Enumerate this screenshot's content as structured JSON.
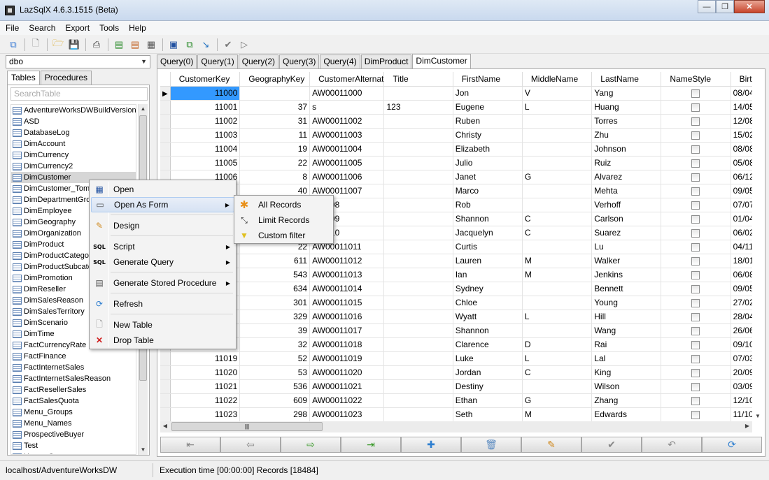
{
  "window": {
    "title": "LazSqlX 4.6.3.1515 (Beta)",
    "minimize": "—",
    "maximize": "❐",
    "close": "✕"
  },
  "menu": [
    "File",
    "Search",
    "Export",
    "Tools",
    "Help"
  ],
  "toolbar": {
    "icons": [
      "connect-icon",
      "new-icon",
      "open-icon",
      "save-icon",
      "print-icon",
      "export-icon",
      "script-icon",
      "generate-icon",
      "design-icon",
      "copy-icon",
      "import-icon",
      "check-icon",
      "run-icon"
    ]
  },
  "schema": {
    "value": "dbo"
  },
  "left_tabs": [
    "Tables",
    "Procedures"
  ],
  "search": {
    "placeholder": "SearchTable"
  },
  "tables": [
    "AdventureWorksDWBuildVersion",
    "ASD",
    "DatabaseLog",
    "DimAccount",
    "DimCurrency",
    "DimCurrency2",
    "DimCustomer",
    "DimCustomer_Tomb",
    "DimDepartmentGrou",
    "DimEmployee",
    "DimGeography",
    "DimOrganization",
    "DimProduct",
    "DimProductCategor",
    "DimProductSubcate",
    "DimPromotion",
    "DimReseller",
    "DimSalesReason",
    "DimSalesTerritory",
    "DimScenario",
    "DimTime",
    "FactCurrencyRate",
    "FactFinance",
    "FactInternetSales",
    "FactInternetSalesReason",
    "FactResellerSales",
    "FactSalesQuota",
    "Menu_Groups",
    "Menu_Names",
    "ProspectiveBuyer",
    "Test",
    "Users_Groups"
  ],
  "selected_table": "DimCustomer",
  "query_tabs": [
    "Query(0)",
    "Query(1)",
    "Query(2)",
    "Query(3)",
    "Query(4)",
    "DimProduct",
    "DimCustomer"
  ],
  "active_tab": "DimCustomer",
  "grid": {
    "columns": [
      "CustomerKey",
      "GeographyKey",
      "CustomerAlternat",
      "Title",
      "FirstName",
      "MiddleName",
      "LastName",
      "NameStyle",
      "BirthD"
    ],
    "rows": [
      [
        "11000",
        "",
        "AW00011000",
        "",
        "Jon",
        "V",
        "Yang",
        "",
        "08/04"
      ],
      [
        "11001",
        "37",
        "s",
        "123",
        "Eugene",
        "L",
        "Huang",
        "",
        "14/05"
      ],
      [
        "11002",
        "31",
        "AW00011002",
        "",
        "Ruben",
        "",
        "Torres",
        "",
        "12/08"
      ],
      [
        "11003",
        "11",
        "AW00011003",
        "",
        "Christy",
        "",
        "Zhu",
        "",
        "15/02"
      ],
      [
        "11004",
        "19",
        "AW00011004",
        "",
        "Elizabeth",
        "",
        "Johnson",
        "",
        "08/08"
      ],
      [
        "11005",
        "22",
        "AW00011005",
        "",
        "Julio",
        "",
        "Ruiz",
        "",
        "05/08"
      ],
      [
        "11006",
        "8",
        "AW00011006",
        "",
        "Janet",
        "G",
        "Alvarez",
        "",
        "06/12"
      ],
      [
        "",
        "40",
        "AW00011007",
        "",
        "Marco",
        "",
        "Mehta",
        "",
        "09/05"
      ],
      [
        "",
        "",
        "011008",
        "",
        "Rob",
        "",
        "Verhoff",
        "",
        "07/07"
      ],
      [
        "",
        "",
        "011009",
        "",
        "Shannon",
        "C",
        "Carlson",
        "",
        "01/04"
      ],
      [
        "",
        "",
        "011010",
        "",
        "Jacquelyn",
        "C",
        "Suarez",
        "",
        "06/02"
      ],
      [
        "",
        "22",
        "AW00011011",
        "",
        "Curtis",
        "",
        "Lu",
        "",
        "04/11"
      ],
      [
        "",
        "611",
        "AW00011012",
        "",
        "Lauren",
        "M",
        "Walker",
        "",
        "18/01"
      ],
      [
        "",
        "543",
        "AW00011013",
        "",
        "Ian",
        "M",
        "Jenkins",
        "",
        "06/08"
      ],
      [
        "",
        "634",
        "AW00011014",
        "",
        "Sydney",
        "",
        "Bennett",
        "",
        "09/05"
      ],
      [
        "",
        "301",
        "AW00011015",
        "",
        "Chloe",
        "",
        "Young",
        "",
        "27/02"
      ],
      [
        "",
        "329",
        "AW00011016",
        "",
        "Wyatt",
        "L",
        "Hill",
        "",
        "28/04"
      ],
      [
        "",
        "39",
        "AW00011017",
        "",
        "Shannon",
        "",
        "Wang",
        "",
        "26/06"
      ],
      [
        "",
        "32",
        "AW00011018",
        "",
        "Clarence",
        "D",
        "Rai",
        "",
        "09/10"
      ],
      [
        "11019",
        "52",
        "AW00011019",
        "",
        "Luke",
        "L",
        "Lal",
        "",
        "07/03"
      ],
      [
        "11020",
        "53",
        "AW00011020",
        "",
        "Jordan",
        "C",
        "King",
        "",
        "20/09"
      ],
      [
        "11021",
        "536",
        "AW00011021",
        "",
        "Destiny",
        "",
        "Wilson",
        "",
        "03/09"
      ],
      [
        "11022",
        "609",
        "AW00011022",
        "",
        "Ethan",
        "G",
        "Zhang",
        "",
        "12/10"
      ],
      [
        "11023",
        "298",
        "AW00011023",
        "",
        "Seth",
        "M",
        "Edwards",
        "",
        "11/10"
      ]
    ]
  },
  "nav_buttons": [
    "first-icon",
    "prior-icon",
    "next-icon",
    "last-icon",
    "insert-icon",
    "delete-icon",
    "edit-icon",
    "post-icon",
    "cancel-icon",
    "refresh-icon"
  ],
  "context_menu": {
    "open": "Open",
    "open_as_form": "Open As Form",
    "design": "Design",
    "script": "Script",
    "generate_query": "Generate Query",
    "generate_sp": "Generate Stored Procedure",
    "refresh": "Refresh",
    "new_table": "New Table",
    "drop_table": "Drop Table"
  },
  "submenu": {
    "all_records": "All Records",
    "limit_records": "Limit Records",
    "custom_filter": "Custom filter"
  },
  "status": {
    "connection": "localhost/AdventureWorksDW",
    "execution": "Execution time [00:00:00] Records [18484]"
  }
}
